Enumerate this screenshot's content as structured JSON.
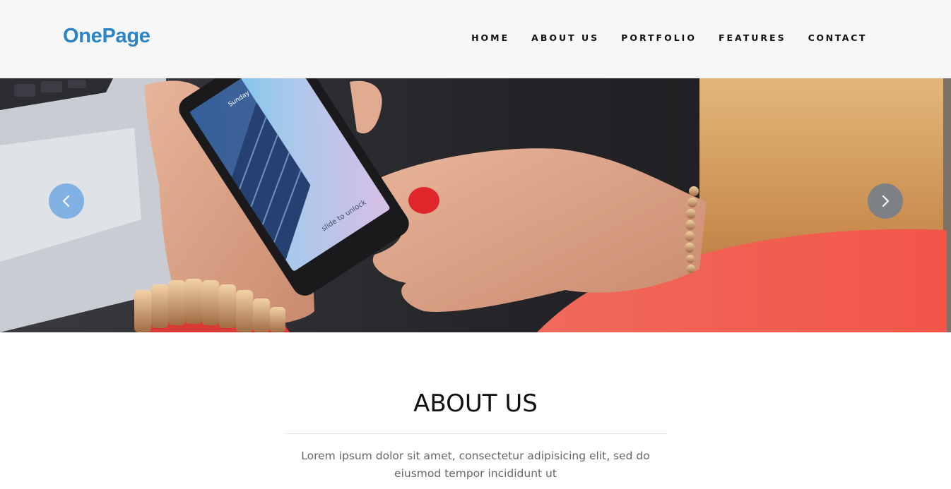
{
  "brand": {
    "name": "OnePage",
    "color": "#2a84c6"
  },
  "nav": {
    "items": [
      {
        "label": "HOME"
      },
      {
        "label": "ABOUT US"
      },
      {
        "label": "PORTFOLIO"
      },
      {
        "label": "FEATURES"
      },
      {
        "label": "CONTACT"
      }
    ]
  },
  "hero": {
    "phone_screen_text": [
      "Sunday",
      "slide to unlock"
    ],
    "prev_icon": "chevron-left-icon",
    "next_icon": "chevron-right-icon",
    "nail_color": "#e0262b",
    "shirt_color": "#f1524a"
  },
  "about": {
    "title": "ABOUT US",
    "text": "Lorem ipsum dolor sit amet, consectetur adipisicing elit, sed do eiusmod tempor incididunt ut"
  }
}
